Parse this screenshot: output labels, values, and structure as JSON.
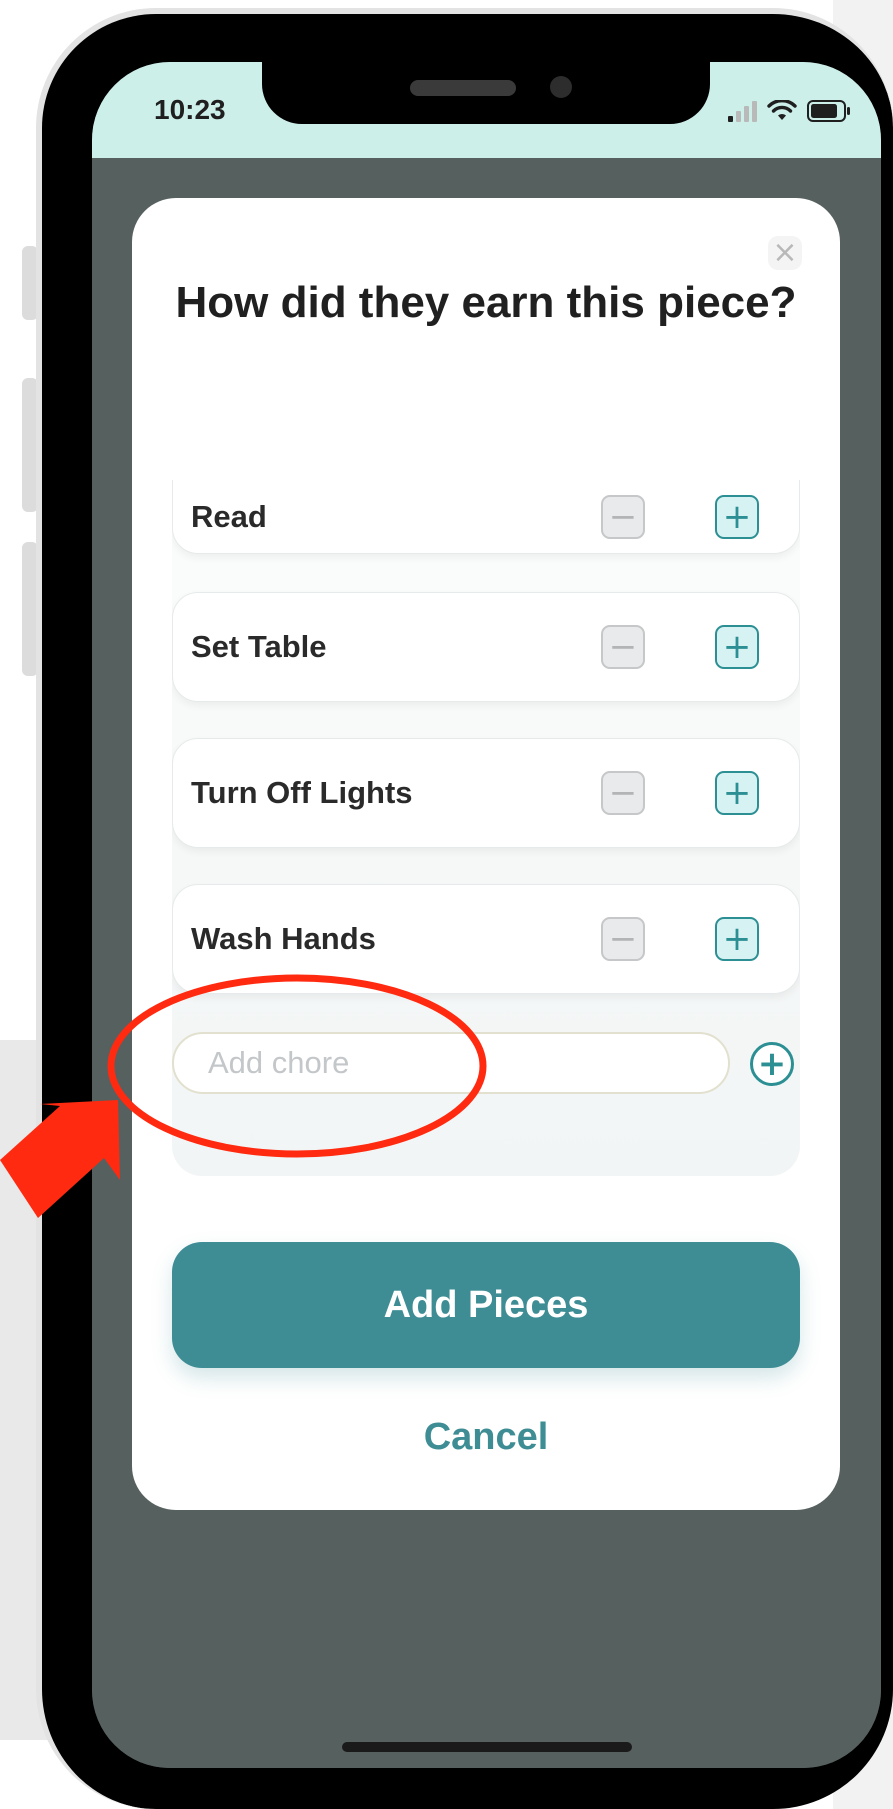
{
  "status_bar": {
    "time": "10:23"
  },
  "modal": {
    "title": "How did they earn this piece?",
    "chores": [
      {
        "label": "Read"
      },
      {
        "label": "Set Table"
      },
      {
        "label": "Turn Off Lights"
      },
      {
        "label": "Wash Hands"
      }
    ],
    "add_chore": {
      "placeholder": "Add chore",
      "value": ""
    },
    "primary_button": "Add Pieces",
    "secondary_button": "Cancel"
  },
  "icons": {
    "close": "close-icon",
    "decrement": "minus-icon",
    "increment": "plus-icon",
    "add": "plus-circle-icon",
    "signal": "cellular-signal-icon",
    "wifi": "wifi-icon",
    "battery": "battery-icon"
  },
  "colors": {
    "accent": "#3e8d95",
    "status_bar": "#cdefea",
    "overlay": "#56605f",
    "annotation": "#ff2a10"
  }
}
